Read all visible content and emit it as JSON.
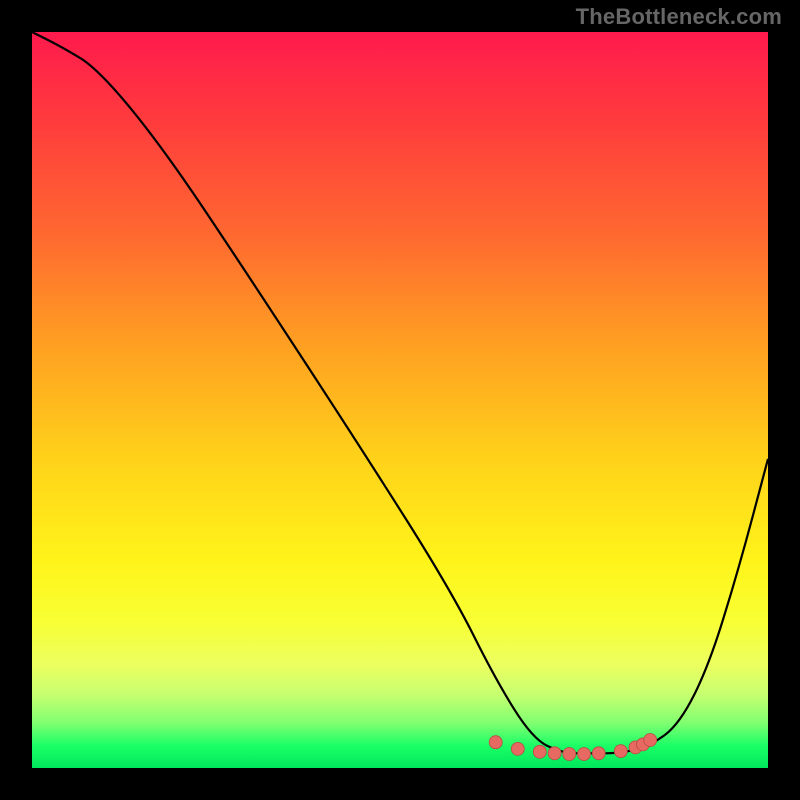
{
  "watermark": "TheBottleneck.com",
  "chart_data": {
    "type": "line",
    "title": "",
    "xlabel": "",
    "ylabel": "",
    "xlim": [
      0,
      100
    ],
    "ylim": [
      0,
      100
    ],
    "series": [
      {
        "name": "bottleneck-curve",
        "x": [
          0,
          4,
          9,
          18,
          30,
          45,
          57,
          63,
          68,
          72,
          76,
          80,
          84,
          88,
          92,
          96,
          100
        ],
        "y": [
          100,
          98,
          95,
          84,
          66,
          43,
          24,
          12,
          4,
          2,
          2,
          2,
          3,
          6,
          14,
          27,
          42
        ]
      }
    ],
    "highlighted_points": {
      "name": "min-region-dots",
      "x": [
        63,
        66,
        69,
        71,
        73,
        75,
        77,
        80,
        82,
        83,
        84
      ],
      "y": [
        3.5,
        2.6,
        2.2,
        2.0,
        1.9,
        1.9,
        2.0,
        2.3,
        2.8,
        3.2,
        3.8
      ]
    },
    "colors": {
      "gradient_top": "#ff1a4d",
      "gradient_mid": "#fff41a",
      "gradient_bottom": "#00e65c",
      "curve": "#000000",
      "dots": "#e66a62",
      "background": "#000000"
    }
  }
}
